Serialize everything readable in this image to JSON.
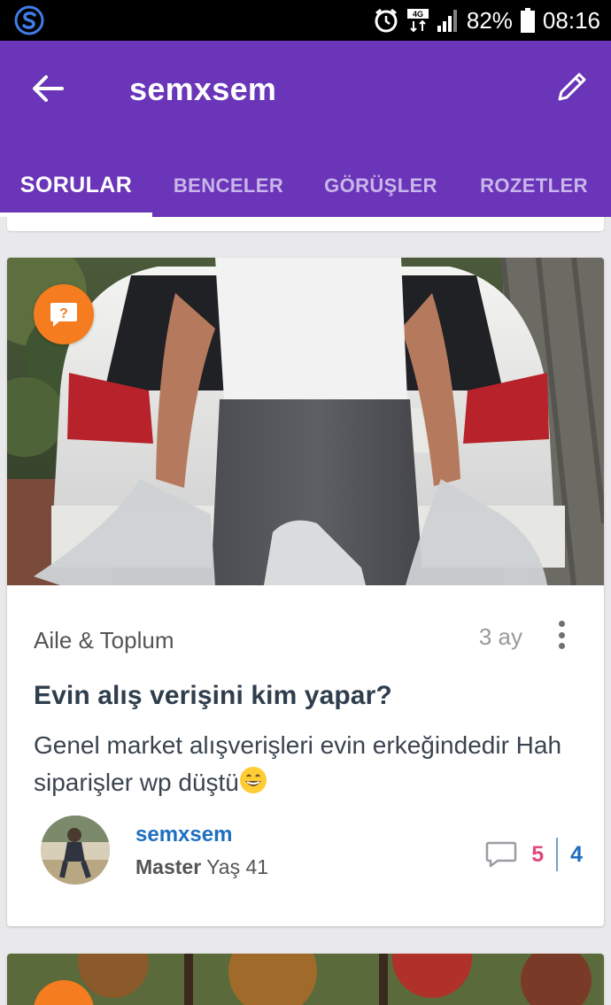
{
  "status_bar": {
    "network": "4G",
    "battery": "82%",
    "time": "08:16"
  },
  "app_bar": {
    "title": "semxsem",
    "tabs": [
      {
        "label": "SORULAR",
        "active": true
      },
      {
        "label": "BENCELER",
        "active": false
      },
      {
        "label": "GÖRÜŞLER",
        "active": false
      },
      {
        "label": "ROZETLER",
        "active": false
      }
    ]
  },
  "post": {
    "category": "Aile & Toplum",
    "time_ago": "3 ay",
    "title": "Evin alış verişini kim yapar?",
    "body": "Genel market alışverişleri evin erkeğindedir Hah siparişler wp düştü",
    "author": {
      "name": "semxsem",
      "rank": "Master",
      "age": "Yaş 41"
    },
    "stats": {
      "comments": "5",
      "answers": "4"
    },
    "colors": {
      "accent": "#6a35b8",
      "badge": "#f57c1f",
      "pink": "#e0487f",
      "blue": "#1e6fc0"
    }
  }
}
